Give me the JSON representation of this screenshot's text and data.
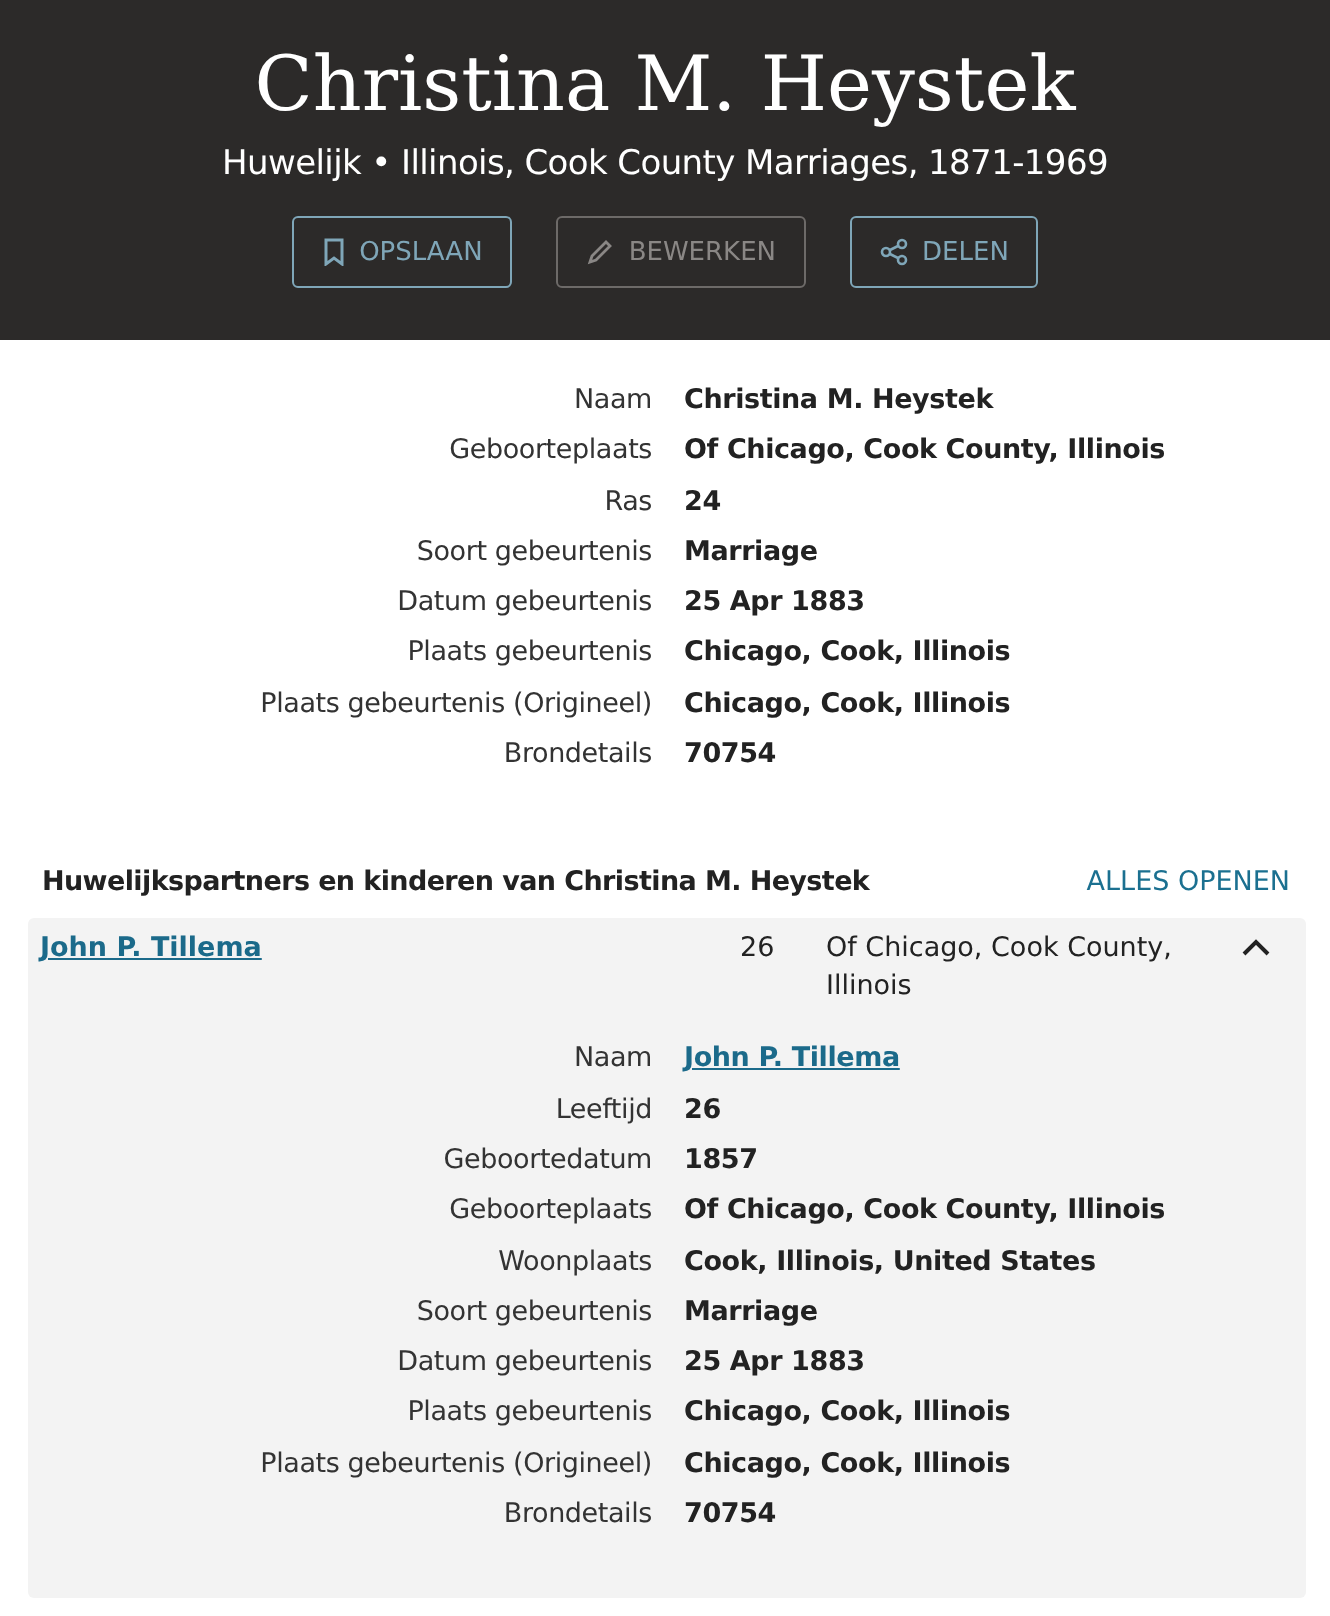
{
  "header": {
    "title": "Christina M. Heystek",
    "subtitle": "Huwelijk • Illinois, Cook County Marriages, 1871-1969",
    "buttons": [
      {
        "label": "OPSLAAN",
        "kind": "save",
        "disabled": false
      },
      {
        "label": "BEWERKEN",
        "kind": "edit",
        "disabled": true
      },
      {
        "label": "DELEN",
        "kind": "share",
        "disabled": false
      }
    ]
  },
  "facts": [
    {
      "label": "Naam",
      "value": "Christina M. Heystek"
    },
    {
      "label": "Geboorteplaats",
      "value": "Of Chicago, Cook County, Illinois"
    },
    {
      "label": "Ras",
      "value": "24"
    },
    {
      "label": "Soort gebeurtenis",
      "value": "Marriage"
    },
    {
      "label": "Datum gebeurtenis",
      "value": "25 Apr 1883"
    },
    {
      "label": "Plaats gebeurtenis",
      "value": "Chicago, Cook, Illinois"
    },
    {
      "label": "Plaats gebeurtenis (Origineel)",
      "value": "Chicago, Cook, Illinois"
    },
    {
      "label": "Brondetails",
      "value": "70754"
    }
  ],
  "relations": {
    "heading": "Huwelijkspartners en kinderen van Christina M. Heystek",
    "open_all": "ALLES OPENEN",
    "people": [
      {
        "name": "John P. Tillema",
        "age": "26",
        "place": "Of Chicago, Cook County, Illinois",
        "expanded": true,
        "facts": [
          {
            "label": "Naam",
            "value": "John P. Tillema",
            "kind": "link"
          },
          {
            "label": "Leeftijd",
            "value": "26",
            "kind": "text"
          },
          {
            "label": "Geboortedatum",
            "value": "1857",
            "kind": "text"
          },
          {
            "label": "Geboorteplaats",
            "value": "Of Chicago, Cook County, Illinois",
            "kind": "text"
          },
          {
            "label": "Woonplaats",
            "value": "Cook, Illinois, United States",
            "kind": "text"
          },
          {
            "label": "Soort gebeurtenis",
            "value": "Marriage",
            "kind": "text"
          },
          {
            "label": "Datum gebeurtenis",
            "value": "25 Apr 1883",
            "kind": "text"
          },
          {
            "label": "Plaats gebeurtenis",
            "value": "Chicago, Cook, Illinois",
            "kind": "text"
          },
          {
            "label": "Plaats gebeurtenis (Origineel)",
            "value": "Chicago, Cook, Illinois",
            "kind": "text"
          },
          {
            "label": "Brondetails",
            "value": "70754",
            "kind": "text"
          }
        ]
      }
    ]
  }
}
